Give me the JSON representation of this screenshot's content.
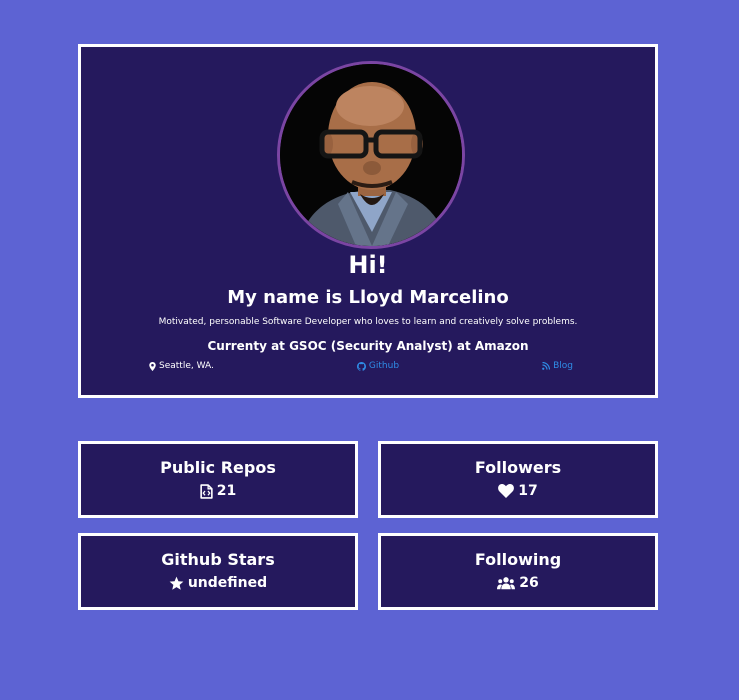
{
  "profile": {
    "greeting": "Hi!",
    "name": "My name is Lloyd Marcelino",
    "bio": "Motivated, personable Software Developer who loves to learn and creatively solve problems.",
    "work": "Currenty at GSOC (Security Analyst) at Amazon",
    "location": "Seattle, WA.",
    "github_label": "Github",
    "blog_label": "Blog"
  },
  "stats": {
    "public_repos": {
      "title": "Public Repos",
      "value": "21",
      "icon": "file-code-icon"
    },
    "followers": {
      "title": "Followers",
      "value": "17",
      "icon": "heart-icon"
    },
    "stars": {
      "title": "Github Stars",
      "value": "undefined",
      "icon": "star-icon"
    },
    "following": {
      "title": "Following",
      "value": "26",
      "icon": "users-icon"
    }
  },
  "colors": {
    "background": "#5d63d3",
    "card": "#25195d",
    "border": "#ffffff",
    "link": "#2f8ce6",
    "avatar_ring": "#7b45a3"
  }
}
